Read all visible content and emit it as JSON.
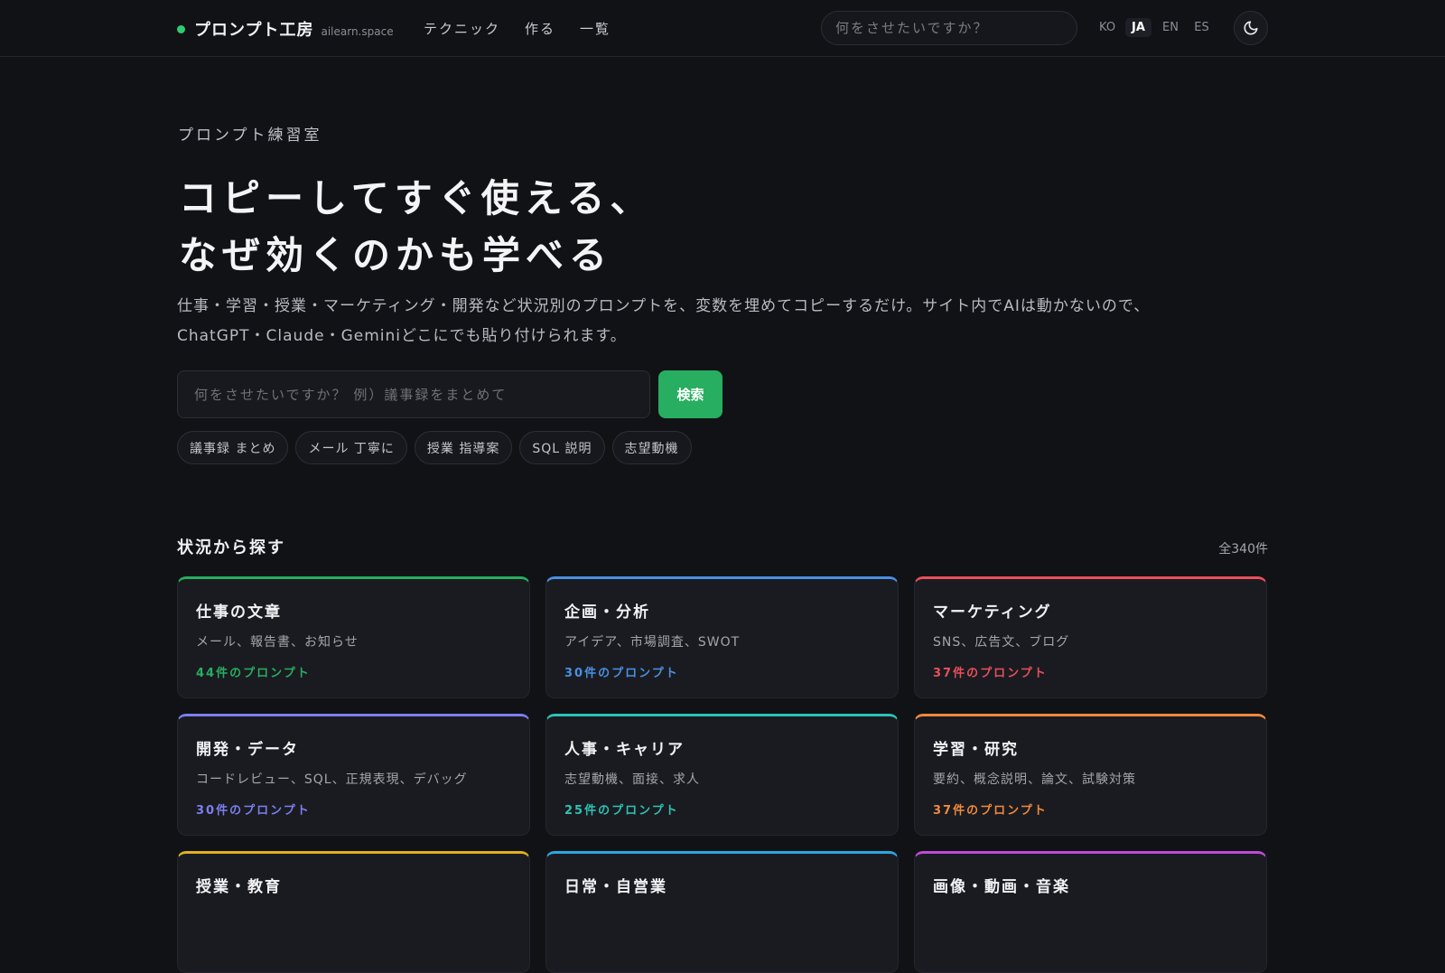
{
  "header": {
    "brand_name": "プロンプト工房",
    "brand_domain": "ailearn.space",
    "nav": [
      "テクニック",
      "作る",
      "一覧"
    ],
    "search_placeholder": "何をさせたいですか？",
    "languages": [
      "KO",
      "JA",
      "EN",
      "ES"
    ],
    "active_language": "JA",
    "theme_toggle_icon": "moon-icon"
  },
  "hero": {
    "eyebrow": "プロンプト練習室",
    "title_line1": "コピーしてすぐ使える、",
    "title_line2": "なぜ効くのかも学べる",
    "description_line1": "仕事・学習・授業・マーケティング・開発など状況別のプロンプトを、変数を埋めてコピーするだけ。サイト内でAIは動かないので、",
    "description_line2": "ChatGPT・Claude・Geminiどこにでも貼り付けられます。",
    "search_placeholder": "何をさせたいですか？ 例）議事録をまとめて",
    "search_button": "検索",
    "chips": [
      "議事録 まとめ",
      "メール 丁寧に",
      "授業 指導案",
      "SQL 説明",
      "志望動機"
    ]
  },
  "section": {
    "title": "状況から探す",
    "count": "全340件"
  },
  "categories": [
    {
      "title": "仕事の文章",
      "subtitle": "メール、報告書、お知らせ",
      "count": "44件のプロンプト",
      "color": "#27ae60"
    },
    {
      "title": "企画・分析",
      "subtitle": "アイデア、市場調査、SWOT",
      "count": "30件のプロンプト",
      "color": "#4a90e2"
    },
    {
      "title": "マーケティング",
      "subtitle": "SNS、広告文、ブログ",
      "count": "37件のプロンプト",
      "color": "#e8505b"
    },
    {
      "title": "開発・データ",
      "subtitle": "コードレビュー、SQL、正規表現、デバッグ",
      "count": "30件のプロンプト",
      "color": "#7b7ff0"
    },
    {
      "title": "人事・キャリア",
      "subtitle": "志望動機、面接、求人",
      "count": "25件のプロンプト",
      "color": "#2bc4b4"
    },
    {
      "title": "学習・研究",
      "subtitle": "要約、概念説明、論文、試験対策",
      "count": "37件のプロンプト",
      "color": "#f08a3e"
    },
    {
      "title": "授業・教育",
      "subtitle": "",
      "count": "",
      "color": "#e0b020"
    },
    {
      "title": "日常・自営業",
      "subtitle": "",
      "count": "",
      "color": "#2aa8e0"
    },
    {
      "title": "画像・動画・音楽",
      "subtitle": "",
      "count": "",
      "color": "#c04ad8"
    }
  ]
}
